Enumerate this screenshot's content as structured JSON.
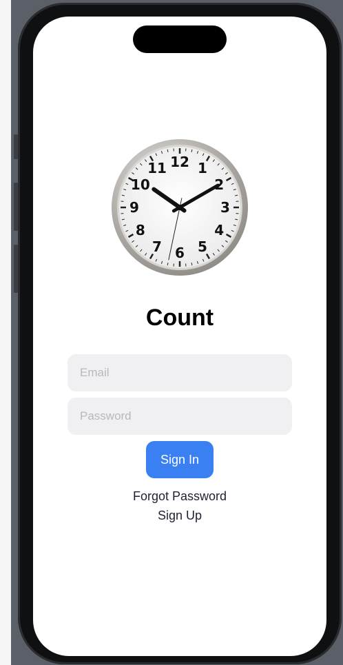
{
  "app": {
    "title": "Count"
  },
  "form": {
    "email_placeholder": "Email",
    "password_placeholder": "Password",
    "signin_label": "Sign In",
    "forgot_label": "Forgot Password",
    "signup_label": "Sign Up"
  },
  "clock": {
    "numerals": [
      "12",
      "1",
      "2",
      "3",
      "4",
      "5",
      "6",
      "7",
      "8",
      "9",
      "10",
      "11"
    ],
    "time": {
      "hours": 10,
      "minutes": 10,
      "seconds": 32
    }
  },
  "colors": {
    "accent": "#3a80f2",
    "field_bg": "#f0f0f2",
    "frame": "#0f1012"
  }
}
